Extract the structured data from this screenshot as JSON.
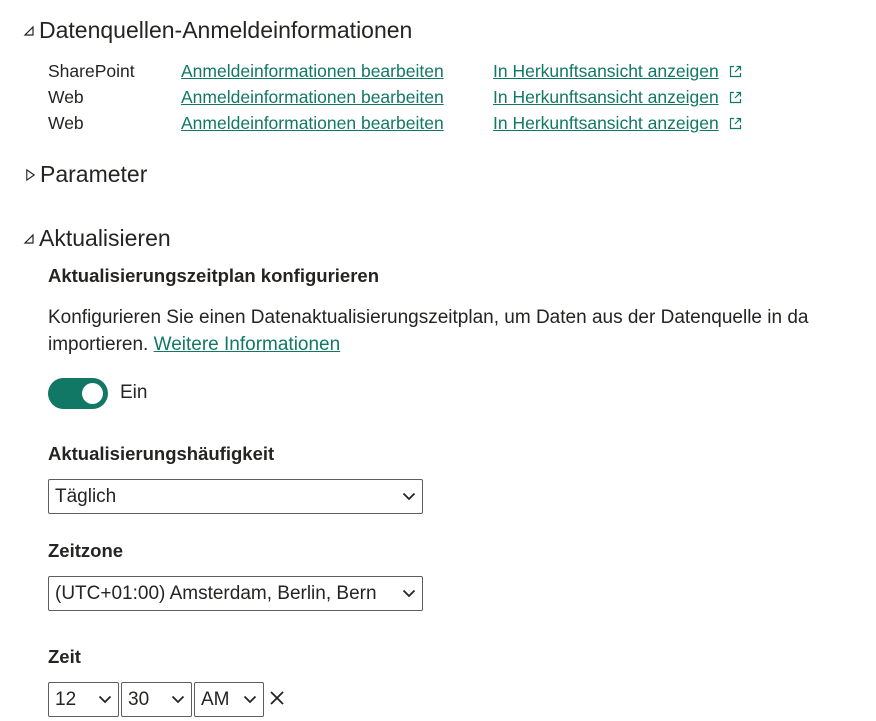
{
  "sections": {
    "credentials_title": "Datenquellen-Anmeldeinformationen",
    "parameters_title": "Parameter",
    "refresh_title": "Aktualisieren"
  },
  "datasources": [
    {
      "name": "SharePoint",
      "edit_link": "Anmeldeinformationen bearbeiten",
      "view_link": "In Herkunftsansicht anzeigen"
    },
    {
      "name": "Web",
      "edit_link": "Anmeldeinformationen bearbeiten",
      "view_link": "In Herkunftsansicht anzeigen"
    },
    {
      "name": "Web",
      "edit_link": "Anmeldeinformationen bearbeiten",
      "view_link": "In Herkunftsansicht anzeigen"
    }
  ],
  "refresh": {
    "schedule_heading": "Aktualisierungszeitplan konfigurieren",
    "description_line1": "Konfigurieren Sie einen Datenaktualisierungszeitplan, um Daten aus der Datenquelle in da",
    "description_line2": "importieren.",
    "more_info_link": "Weitere Informationen",
    "toggle_label": "Ein",
    "toggle_state": "on",
    "frequency_label": "Aktualisierungshäufigkeit",
    "frequency_value": "Täglich",
    "timezone_label": "Zeitzone",
    "timezone_value": "(UTC+01:00) Amsterdam, Berlin, Bern",
    "time_label": "Zeit",
    "time_hour": "12",
    "time_minute": "30",
    "time_ampm": "AM"
  },
  "colors": {
    "accent": "#117865",
    "text": "#252423",
    "border": "#605e5c"
  },
  "icons": {
    "expanded": "triangle-down-right-icon",
    "collapsed": "triangle-right-icon",
    "external_link": "open-in-new-window-icon",
    "dropdown": "chevron-down-icon",
    "remove": "close-icon"
  }
}
